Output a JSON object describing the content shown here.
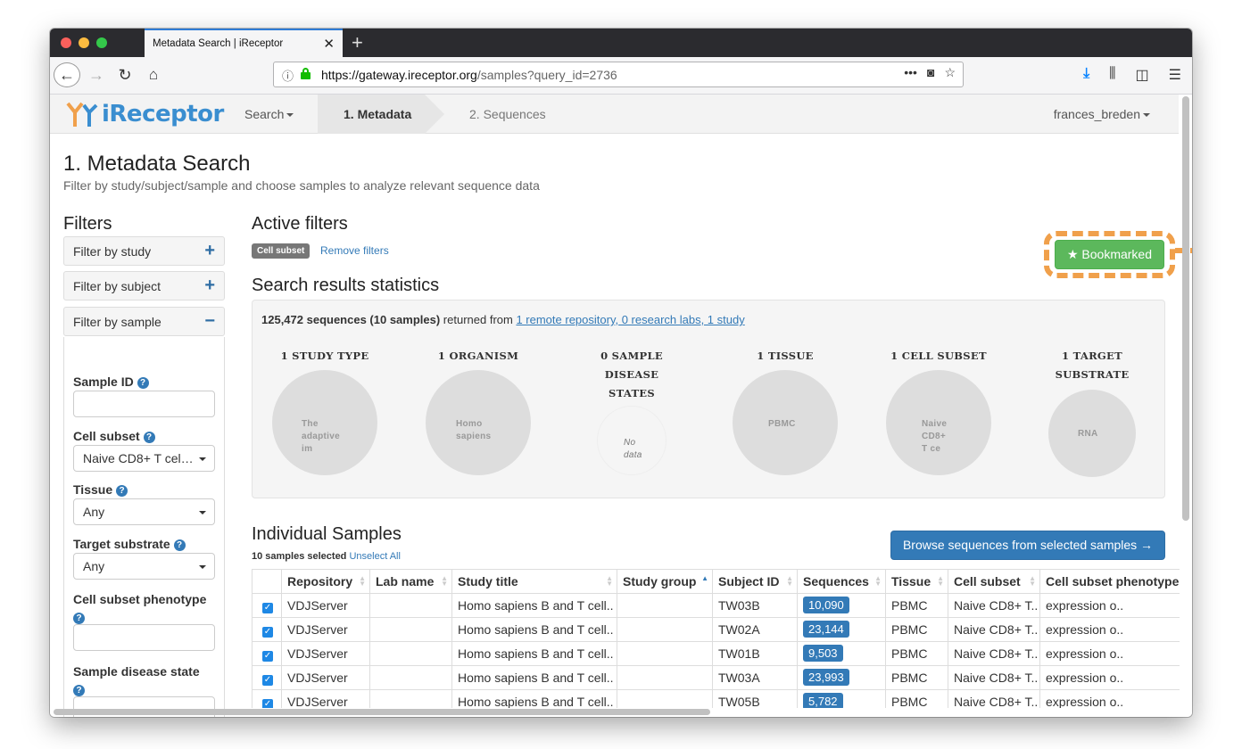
{
  "browser": {
    "tab_title": "Metadata Search | iReceptor",
    "url_host": "https://gateway.ireceptor.org",
    "url_path": "/samples?query_id=2736"
  },
  "app": {
    "logo_text": "iReceptor",
    "menu_search": "Search",
    "crumb_active": "1. Metadata",
    "crumb_next": "2. Sequences",
    "user": "frances_breden"
  },
  "page": {
    "title": "1. Metadata Search",
    "subtitle": "Filter by study/subject/sample and choose samples to analyze relevant sequence data"
  },
  "filters": {
    "heading": "Filters",
    "panels": [
      {
        "label": "Filter by study",
        "sign": "+"
      },
      {
        "label": "Filter by subject",
        "sign": "+"
      },
      {
        "label": "Filter by sample",
        "sign": "−"
      }
    ],
    "fields": {
      "sample_id": {
        "label": "Sample ID",
        "value": ""
      },
      "cell_subset": {
        "label": "Cell subset",
        "value": "Naive CD8+ T cel…"
      },
      "tissue": {
        "label": "Tissue",
        "value": "Any"
      },
      "target_substrate": {
        "label": "Target substrate",
        "value": "Any"
      },
      "cell_subset_phenotype": {
        "label": "Cell subset phenotype",
        "value": ""
      },
      "sample_disease_state": {
        "label": "Sample disease state",
        "value": ""
      }
    }
  },
  "active_filters": {
    "heading": "Active filters",
    "badge": "Cell subset",
    "remove_link": "Remove filters",
    "bookmark_label": "★ Bookmarked"
  },
  "stats": {
    "heading": "Search results statistics",
    "summary_bold": "125,472 sequences (10 samples)",
    "summary_mid": " returned from ",
    "summary_link": "1 remote repository, 0 research labs, 1 study",
    "columns": [
      {
        "title": "1 STUDY TYPE",
        "circle": "The\nadaptive\nim"
      },
      {
        "title": "1 ORGANISM",
        "circle": "Homo\nsapiens"
      },
      {
        "title": "0 SAMPLE DISEASE STATES",
        "circle": "No\ndata"
      },
      {
        "title": "1 TISSUE",
        "circle": "PBMC"
      },
      {
        "title": "1 CELL SUBSET",
        "circle": "Naive\nCD8+\nT ce"
      },
      {
        "title": "1 TARGET SUBSTRATE",
        "circle": "RNA"
      }
    ]
  },
  "samples": {
    "heading": "Individual Samples",
    "selected_count": "10 samples selected",
    "unselect": "Unselect All",
    "browse_button": "Browse sequences from selected samples →",
    "headers": [
      "Repository",
      "Lab name",
      "Study title",
      "Study group",
      "Subject ID",
      "Sequences",
      "Tissue",
      "Cell subset",
      "Cell subset phenotype"
    ],
    "rows": [
      {
        "repository": "VDJServer",
        "lab": "",
        "study": "Homo sapiens B and T cell..",
        "group": "",
        "subject": "TW03B",
        "sequences": "10,090",
        "tissue": "PBMC",
        "cell_subset": "Naive CD8+ T..",
        "phenotype": "expression o.."
      },
      {
        "repository": "VDJServer",
        "lab": "",
        "study": "Homo sapiens B and T cell..",
        "group": "",
        "subject": "TW02A",
        "sequences": "23,144",
        "tissue": "PBMC",
        "cell_subset": "Naive CD8+ T..",
        "phenotype": "expression o.."
      },
      {
        "repository": "VDJServer",
        "lab": "",
        "study": "Homo sapiens B and T cell..",
        "group": "",
        "subject": "TW01B",
        "sequences": "9,503",
        "tissue": "PBMC",
        "cell_subset": "Naive CD8+ T..",
        "phenotype": "expression o.."
      },
      {
        "repository": "VDJServer",
        "lab": "",
        "study": "Homo sapiens B and T cell..",
        "group": "",
        "subject": "TW03A",
        "sequences": "23,993",
        "tissue": "PBMC",
        "cell_subset": "Naive CD8+ T..",
        "phenotype": "expression o.."
      },
      {
        "repository": "VDJServer",
        "lab": "",
        "study": "Homo sapiens B and T cell..",
        "group": "",
        "subject": "TW05B",
        "sequences": "5,782",
        "tissue": "PBMC",
        "cell_subset": "Naive CD8+ T..",
        "phenotype": "expression o.."
      }
    ]
  },
  "colors": {
    "brand_blue": "#337ab7",
    "success_green": "#5cb85c",
    "highlight_orange": "#f0a04b"
  }
}
